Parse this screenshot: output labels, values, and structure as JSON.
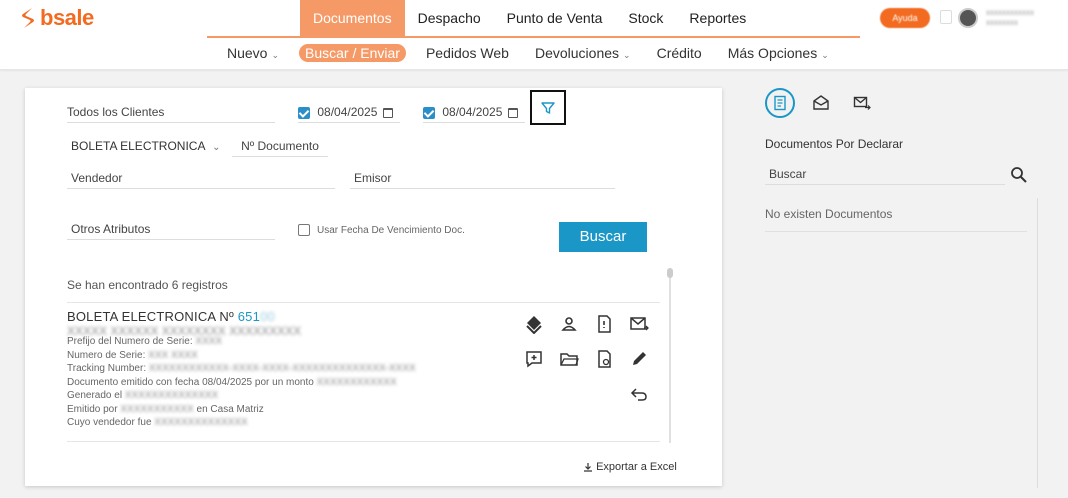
{
  "brand": {
    "name": "bsale",
    "color": "#f26b21"
  },
  "main_nav": [
    "Documentos",
    "Despacho",
    "Punto de Venta",
    "Stock",
    "Reportes"
  ],
  "main_nav_active": "Documentos",
  "sub_nav": [
    {
      "label": "Nuevo",
      "dropdown": true
    },
    {
      "label": "Buscar / Enviar",
      "dropdown": false
    },
    {
      "label": "Pedidos Web",
      "dropdown": false
    },
    {
      "label": "Devoluciones",
      "dropdown": true
    },
    {
      "label": "Crédito",
      "dropdown": false
    },
    {
      "label": "Más Opciones",
      "dropdown": true
    }
  ],
  "sub_nav_active": "Buscar / Enviar",
  "filters": {
    "clients": "Todos los Clientes",
    "date_from": "08/04/2025",
    "date_to": "08/04/2025",
    "doc_type": "BOLETA ELECTRONICA",
    "doc_number_placeholder": "Nº Documento",
    "seller_placeholder": "Vendedor",
    "issuer_placeholder": "Emisor",
    "other_attributes": "Otros Atributos",
    "use_due_date_label": "Usar Fecha De Vencimiento Doc.",
    "search_button": "Buscar"
  },
  "results_summary": "Se han encontrado 6 registros",
  "document": {
    "title_prefix": "BOLETA ELECTRONICA Nº",
    "number_visible": "651",
    "lines": [
      "Prefijo del Numero de Serie:",
      "Numero de Serie:",
      "Tracking Number:",
      "Documento emitido con fecha 08/04/2025 por un monto",
      "Generado el",
      "Emitido por",
      "Cuyo vendedor fue"
    ],
    "emitted_suffix": "en Casa Matriz"
  },
  "export_label": "Exportar a Excel",
  "sidebar": {
    "title": "Documentos Por Declarar",
    "search_placeholder": "Buscar",
    "empty_text": "No existen Documentos"
  },
  "accent": "#1b97c7"
}
